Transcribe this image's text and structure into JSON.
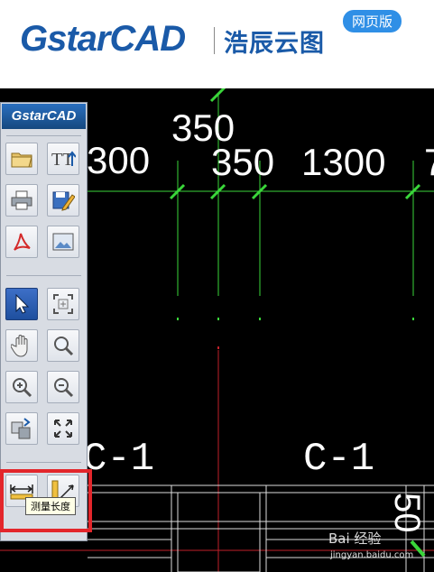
{
  "header": {
    "logo_text": "GstarCAD",
    "product_name": "浩辰云图",
    "badge": "网页版"
  },
  "toolbar": {
    "logo_text": "GstarCAD",
    "tooltip": "测量长度"
  },
  "drawing": {
    "dimensions_top": [
      "350",
      "300",
      "350",
      "1300",
      "7"
    ],
    "labels": [
      "C-1",
      "C-1"
    ],
    "dimension_vertical": "50"
  },
  "watermark": {
    "text": "Bai 经验",
    "sub": "jingyan.baidu.com"
  },
  "colors": {
    "brand": "#1a5aa8",
    "badge": "#2f8fe6",
    "line_green": "#3ad63a",
    "highlight_red": "#e3262b"
  }
}
